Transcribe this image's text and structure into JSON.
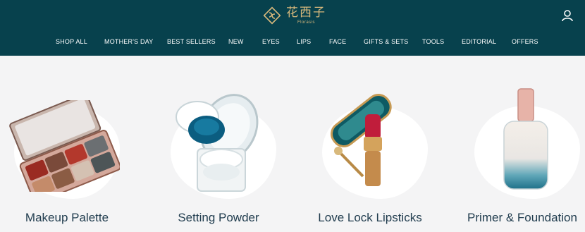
{
  "brand": {
    "name_cn": "花西子",
    "name_en": "Florasis",
    "gold": "#d8b97c",
    "header_bg": "#07414d"
  },
  "nav": {
    "items": [
      {
        "label": "SHOP ALL"
      },
      {
        "label": "MOTHER'S DAY"
      },
      {
        "label": "BEST SELLERS"
      },
      {
        "label": "NEW"
      },
      {
        "label": "EYES"
      },
      {
        "label": "LIPS"
      },
      {
        "label": "FACE"
      },
      {
        "label": "GIFTS & SETS"
      },
      {
        "label": "TOOLS"
      },
      {
        "label": "EDITORIAL"
      },
      {
        "label": "OFFERS"
      }
    ]
  },
  "header_icons": {
    "account": "user-icon"
  },
  "categories": [
    {
      "label": "Makeup Palette",
      "icon": "makeup-palette-image"
    },
    {
      "label": "Setting Powder",
      "icon": "setting-powder-image"
    },
    {
      "label": "Love Lock Lipsticks",
      "icon": "lipstick-image"
    },
    {
      "label": "Primer & Foundation",
      "icon": "primer-bottle-image"
    }
  ]
}
